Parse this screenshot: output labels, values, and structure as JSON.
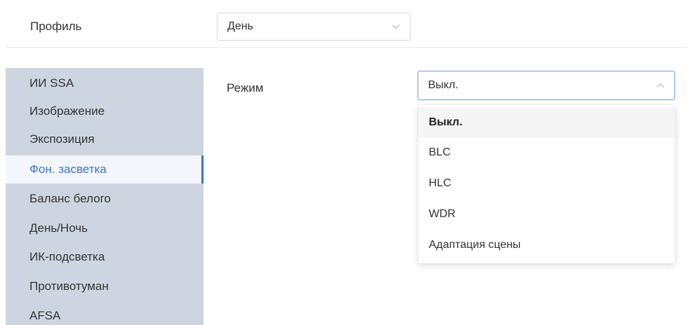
{
  "profile": {
    "label": "Профиль",
    "value": "День"
  },
  "sidebar": {
    "items": [
      {
        "label": "ИИ SSA"
      },
      {
        "label": "Изображение"
      },
      {
        "label": "Экспозиция"
      },
      {
        "label": "Фон. засветка",
        "active": true
      },
      {
        "label": "Баланс белого"
      },
      {
        "label": "День/Ночь"
      },
      {
        "label": "ИК-подсветка"
      },
      {
        "label": "Противотуман"
      },
      {
        "label": "AFSA"
      }
    ]
  },
  "mode": {
    "label": "Режим",
    "value": "Выкл.",
    "options": [
      "Выкл.",
      "BLC",
      "HLC",
      "WDR",
      "Адаптация сцены"
    ]
  },
  "colors": {
    "sidebar_bg": "#cfd5e0",
    "accent": "#3b73c6",
    "active_item_bg": "#f3f7fd",
    "select_focus_border": "#6a9be0"
  }
}
